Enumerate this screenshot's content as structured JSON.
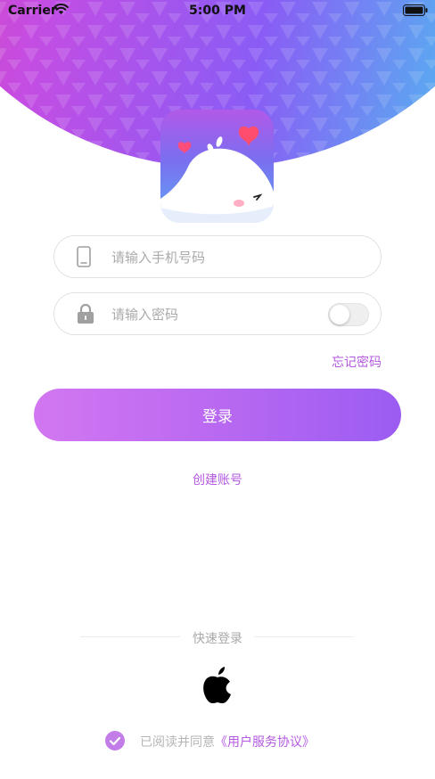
{
  "status_bar": {
    "carrier": "Carrier",
    "time": "5:00 PM"
  },
  "login_form": {
    "phone_placeholder": "请输入手机号码",
    "password_placeholder": "请输入密码",
    "show_password_toggle_on": false,
    "forgot_password_label": "忘记密码",
    "login_button_label": "登录",
    "create_account_label": "创建账号"
  },
  "quick_login": {
    "label": "快速登录",
    "apple_icon": "apple-icon"
  },
  "agreement": {
    "checked": true,
    "text": "已阅读并同意",
    "link_label": "《用户服务协议》"
  },
  "colors": {
    "accent": "#b35ae0",
    "button_gradient_start": "#d277f1",
    "button_gradient_end": "#9b5cf2",
    "header_gradient": [
      "#e9439c",
      "#c44de3",
      "#8a5cf5",
      "#5aaaf1",
      "#40d0f0"
    ]
  }
}
